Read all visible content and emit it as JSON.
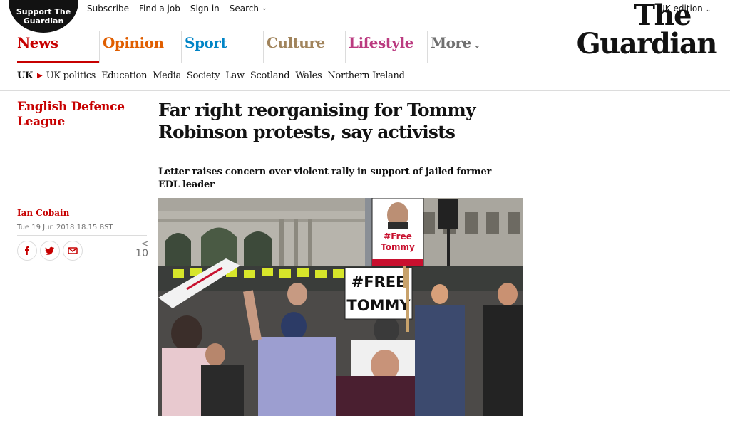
{
  "header": {
    "support": "Support The Guardian",
    "top_links": [
      "Subscribe",
      "Find a job",
      "Sign in",
      "Search"
    ],
    "edition": "UK edition",
    "logo_line1": "The",
    "logo_line2": "Guardian",
    "pillars": [
      "News",
      "Opinion",
      "Sport",
      "Culture",
      "Lifestyle",
      "More"
    ],
    "active_pillar": "News",
    "colors": {
      "news": "#c70000",
      "opinion": "#e05e00",
      "sport": "#0084c6",
      "culture": "#a1845c",
      "lifestyle": "#bb3b80",
      "more": "#707070"
    }
  },
  "subnav": {
    "current": "UK",
    "items": [
      "UK politics",
      "Education",
      "Media",
      "Society",
      "Law",
      "Scotland",
      "Wales",
      "Northern Ireland"
    ]
  },
  "article": {
    "series": "English Defence League",
    "headline": "Far right reorganising for Tommy Robinson protests, say activists",
    "standfirst": "Letter raises concern over violent rally in support of jailed former EDL leader",
    "author": "Ian Cobain",
    "date": "Tue 19 Jun 2018 18.15 BST",
    "share_icons": [
      "facebook-icon",
      "twitter-icon",
      "email-icon"
    ],
    "share_count": "10",
    "photo": {
      "sign_main_line1": "#FREE",
      "sign_main_line2": "TOMMY",
      "sign_top_line1": "#Free",
      "sign_top_line2": "Tommy"
    }
  }
}
